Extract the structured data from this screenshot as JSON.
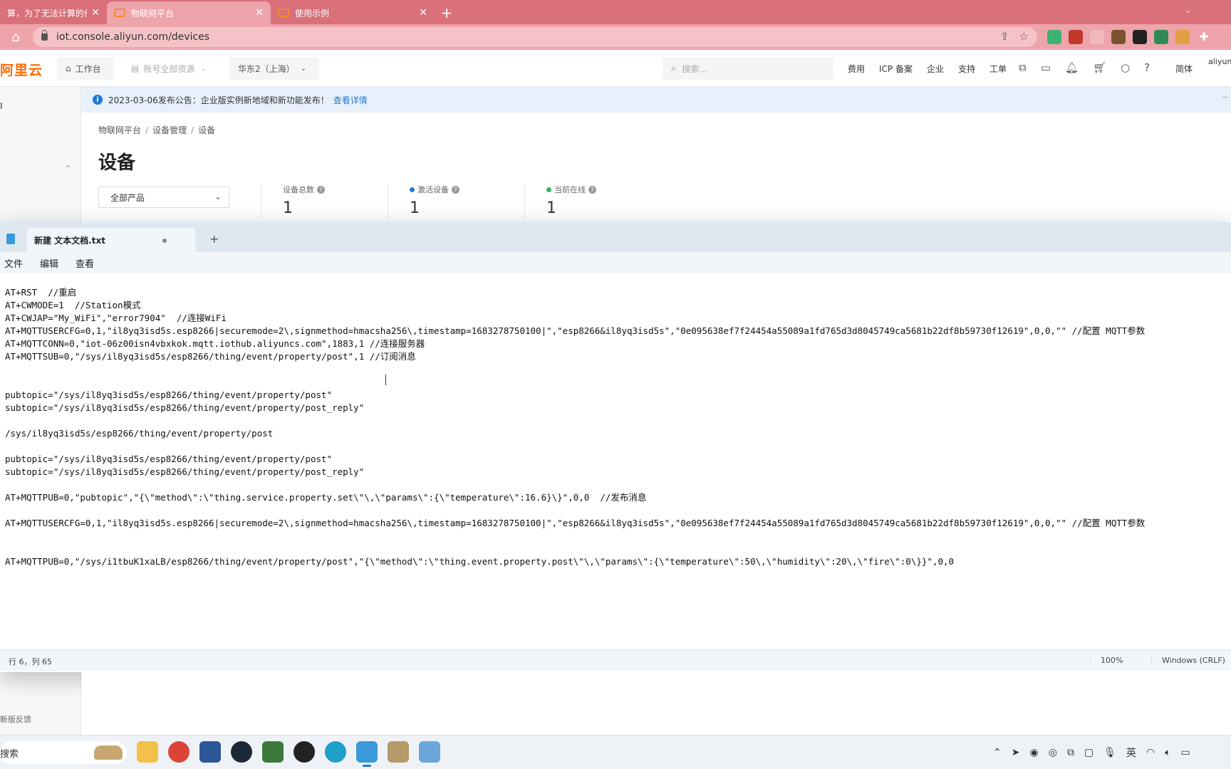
{
  "browser": {
    "tabs": [
      {
        "label": "算，为了无法计算的价"
      },
      {
        "label": "物联网平台"
      },
      {
        "label": "使用示例"
      }
    ],
    "url": "iot.console.aliyun.com/devices"
  },
  "console_header": {
    "logo": "阿里云",
    "workbench": "工作台",
    "account_scope": "账号全部资源",
    "region": "华东2（上海）",
    "search_placeholder": "搜索...",
    "links": [
      "费用",
      "ICP 备案",
      "企业",
      "支持",
      "工单"
    ],
    "language": "简体",
    "user": "aliyun"
  },
  "sidebar": {
    "item": "I",
    "feedback": "新版反馈"
  },
  "notice": {
    "text": "2023-03-06发布公告：企业版实例新地域和新功能发布！",
    "link": "查看详情"
  },
  "breadcrumb": [
    "物联网平台",
    "设备管理",
    "设备"
  ],
  "page_title": "设备",
  "product_filter": "全部产品",
  "stats": [
    {
      "label": "设备总数",
      "value": "1",
      "dot_color": ""
    },
    {
      "label": "激活设备",
      "value": "1",
      "dot_color": "#1f7ad4"
    },
    {
      "label": "当前在线",
      "value": "1",
      "dot_color": "#2db55d"
    }
  ],
  "notepad": {
    "tab_title": "新建 文本文档.txt",
    "menu": [
      "文件",
      "编辑",
      "查看"
    ],
    "lines": [
      "",
      "AT+RST  //重启",
      "AT+CWMODE=1  //Station模式",
      "AT+CWJAP=\"My_WiFi\",\"error7904\"  //连接WiFi",
      "AT+MQTTUSERCFG=0,1,\"il8yq3isd5s.esp8266|securemode=2\\,signmethod=hmacsha256\\,timestamp=1683278750100|\",\"esp8266&il8yq3isd5s\",\"0e095638ef7f24454a55089a1fd765d3d8045749ca5681b22df8b59730f12619\",0,0,\"\" //配置 MQTT参数",
      "AT+MQTTCONN=0,\"iot-06z00isn4vbxkok.mqtt.iothub.aliyuncs.com\",1883,1 //连接服务器",
      "AT+MQTTSUB=0,\"/sys/il8yq3isd5s/esp8266/thing/event/property/post\",1 //订阅消息",
      "",
      "",
      "pubtopic=\"/sys/il8yq3isd5s/esp8266/thing/event/property/post\"",
      "subtopic=\"/sys/il8yq3isd5s/esp8266/thing/event/property/post_reply\"",
      "",
      "/sys/il8yq3isd5s/esp8266/thing/event/property/post",
      "",
      "pubtopic=\"/sys/il8yq3isd5s/esp8266/thing/event/property/post\"",
      "subtopic=\"/sys/il8yq3isd5s/esp8266/thing/event/property/post_reply\"",
      "",
      "AT+MQTTPUB=0,\"pubtopic\",\"{\\\"method\\\":\\\"thing.service.property.set\\\"\\,\\\"params\\\":{\\\"temperature\\\":16.6}\\}\",0,0  //发布消息",
      "",
      "AT+MQTTUSERCFG=0,1,\"il8yq3isd5s.esp8266|securemode=2\\,signmethod=hmacsha256\\,timestamp=1683278750100|\",\"esp8266&il8yq3isd5s\",\"0e095638ef7f24454a55089a1fd765d3d8045749ca5681b22df8b59730f12619\",0,0,\"\" //配置 MQTT参数",
      "",
      "",
      "AT+MQTTPUB=0,\"/sys/i1tbuK1xaLB/esp8266/thing/event/property/post\",\"{\\\"method\\\":\\\"thing.event.property.post\\\"\\,\\\"params\\\":{\\\"temperature\\\":50\\,\\\"humidity\\\":20\\,\\\"fire\\\":0\\}}\",0,0"
    ],
    "status_position": "行 6，列 65",
    "status_zoom": "100%",
    "status_eol": "Windows (CRLF)"
  },
  "taskbar": {
    "search": "搜索",
    "ime": "英"
  }
}
